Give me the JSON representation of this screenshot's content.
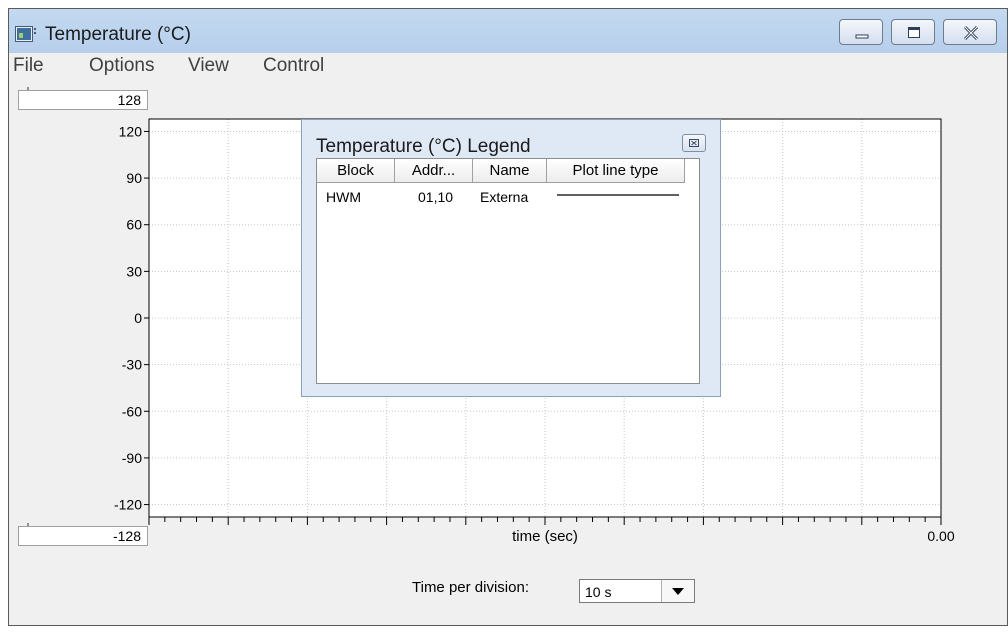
{
  "window": {
    "title": "Temperature (°C)",
    "controls": [
      "minimize-icon",
      "maximize-icon",
      "close-icon"
    ]
  },
  "menu": [
    "File",
    "Options",
    "View",
    "Control"
  ],
  "scale": {
    "max_value": "128",
    "min_value": "-128"
  },
  "chart_data": {
    "type": "line",
    "y_ticks": [
      "120",
      "90",
      "60",
      "30",
      "0",
      "-30",
      "-60",
      "-90",
      "-120"
    ],
    "ylim": [
      -128,
      128
    ],
    "xlabel": "time (sec)",
    "x_end_label": "0.00",
    "series": [],
    "grid": true
  },
  "time_per_division": {
    "label": "Time per division:",
    "value": "10 s"
  },
  "legend": {
    "title": "Temperature (°C) Legend",
    "columns": [
      "Block",
      "Addr...",
      "Name",
      "Plot line type"
    ],
    "rows": [
      {
        "block": "HWM",
        "addr": "01,10",
        "name": "Externa",
        "line_color": "#000000"
      }
    ]
  }
}
